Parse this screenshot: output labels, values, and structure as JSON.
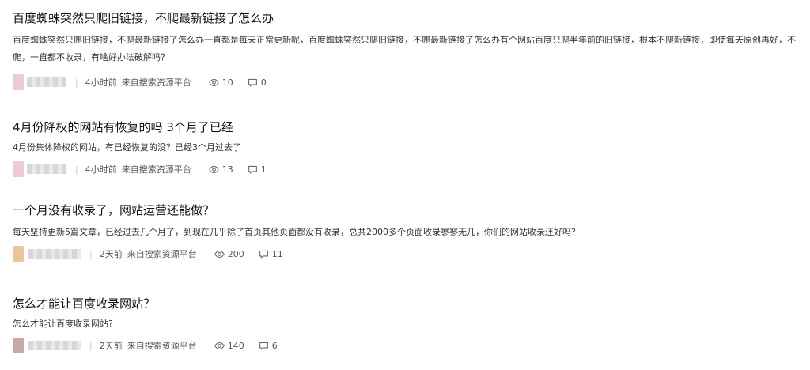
{
  "posts": [
    {
      "title": "百度蜘蛛突然只爬旧链接，不爬最新链接了怎么办",
      "excerpt": "百度蜘蛛突然只爬旧链接，不爬最新链接了怎么办一直都是每天正常更新呢，百度蜘蛛突然只爬旧链接，不爬最新链接了怎么办有个网站百度只爬半年前的旧链接，根本不爬新链接，即使每天原创再好，不爬，一直都不收录，有啥好办法破解吗？",
      "time": "4小时前",
      "source": "来自搜索资源平台",
      "views": "10",
      "comments": "0",
      "avatar_color": "#f1c9d3"
    },
    {
      "title": "4月份降权的网站有恢复的吗 3个月了已经",
      "excerpt": "4月份集体降权的网站，有已经恢复的没？已经3个月过去了",
      "time": "4小时前",
      "source": "来自搜索资源平台",
      "views": "13",
      "comments": "1",
      "avatar_color": "#f1c9d3"
    },
    {
      "title": "一个月没有收录了，网站运营还能做？",
      "excerpt": "每天坚持更新5篇文章，已经过去几个月了，到现在几乎除了首页其他页面都没有收录，总共2000多个页面收录寥寥无几，你们的网站收录还好吗？",
      "time": "2天前",
      "source": "来自搜索资源平台",
      "views": "200",
      "comments": "11",
      "avatar_color": "#eac49e"
    },
    {
      "title": "怎么才能让百度收录网站？",
      "excerpt": "怎么才能让百度收录网站?",
      "time": "2天前",
      "source": "来自搜索资源平台",
      "views": "140",
      "comments": "6",
      "avatar_color": "#c9aaa2"
    }
  ],
  "icons": {
    "views": "eye-icon",
    "comments": "comment-icon"
  }
}
